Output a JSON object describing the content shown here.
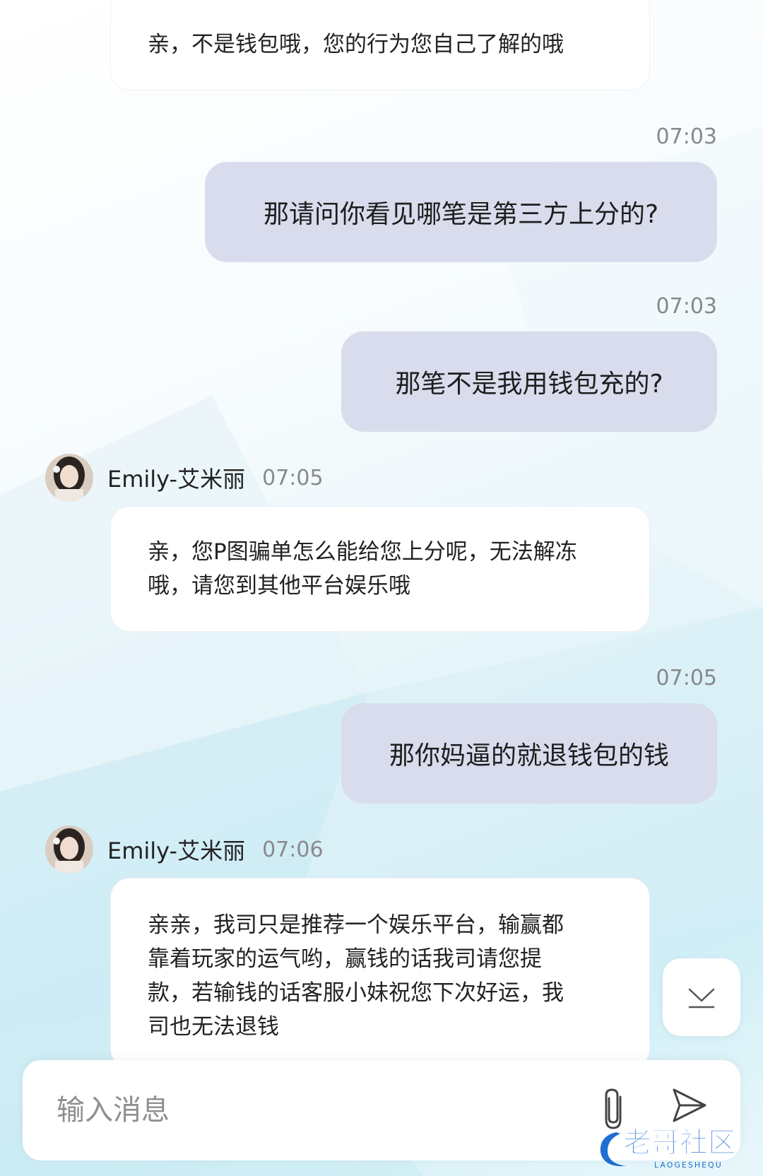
{
  "messages": [
    {
      "type": "incoming",
      "text": "亲，不是钱包哦，您的行为您自己了解的哦"
    },
    {
      "type": "outgoing",
      "time": "07:03",
      "text": "那请问你看见哪笔是第三方上分的?"
    },
    {
      "type": "outgoing",
      "time": "07:03",
      "text": "那笔不是我用钱包充的?"
    },
    {
      "type": "incoming",
      "sender": "Emily-艾米丽",
      "time": "07:05",
      "lines": [
        "亲，您P图骗单怎么能给您上分呢，无法解冻",
        "哦，请您到其他平台娱乐哦"
      ]
    },
    {
      "type": "outgoing",
      "time": "07:05",
      "text": "那你妈逼的就退钱包的钱"
    },
    {
      "type": "incoming",
      "sender": "Emily-艾米丽",
      "time": "07:06",
      "lines": [
        "亲亲，我司只是推荐一个娱乐平台，输赢都",
        "靠着玩家的运气哟，赢钱的话我司请您提",
        "款，若输钱的话客服小妹祝您下次好运，我",
        "司也无法退钱"
      ]
    }
  ],
  "input": {
    "placeholder": "输入消息",
    "value": ""
  },
  "watermark": {
    "text": "老哥社区",
    "subtext": "LAOGESHEQU"
  },
  "icons": {
    "scroll_down": "chevron-down-icon",
    "attach": "paperclip-icon",
    "send": "send-icon"
  },
  "colors": {
    "outgoing_bubble": "#d8dcec",
    "incoming_bubble": "#ffffff",
    "watermark": "#1f6fd1"
  }
}
